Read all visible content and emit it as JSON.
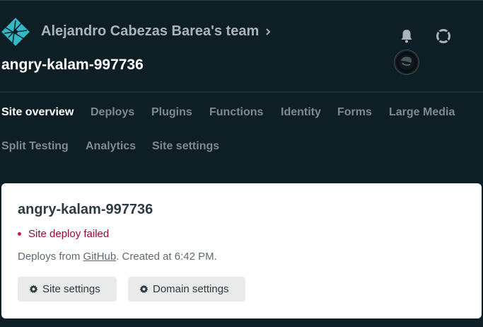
{
  "header": {
    "team_name": "Alejandro Cabezas Barea's team",
    "site_name": "angry-kalam-997736",
    "icons": {
      "logo": "netlify-logo",
      "chevron": "chevron-right-icon",
      "notifications": "bell-icon",
      "help": "lifebuoy-icon",
      "avatar": "user-avatar"
    }
  },
  "nav": {
    "items": [
      {
        "label": "Site overview",
        "active": true
      },
      {
        "label": "Deploys"
      },
      {
        "label": "Plugins"
      },
      {
        "label": "Functions"
      },
      {
        "label": "Identity"
      },
      {
        "label": "Forms"
      },
      {
        "label": "Large Media"
      },
      {
        "label": "Split Testing"
      },
      {
        "label": "Analytics"
      },
      {
        "label": "Site settings"
      }
    ]
  },
  "card": {
    "title": "angry-kalam-997736",
    "status": "Site deploy failed",
    "deploy_prefix": "Deploys from ",
    "provider": "GitHub",
    "created": ". Created at 6:42 PM.",
    "buttons": {
      "site_settings": "Site settings",
      "domain_settings": "Domain settings"
    }
  },
  "colors": {
    "background": "#0e1e25",
    "logo": "#32b8c6",
    "status_error": "#900b31",
    "card": "#ffffff",
    "button": "#e9ebeb"
  }
}
